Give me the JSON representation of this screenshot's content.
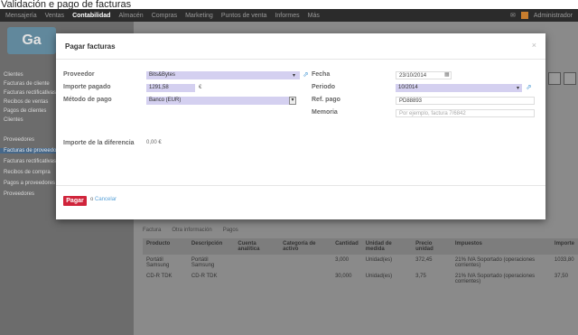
{
  "caption": "Validación e pago de facturas",
  "topbar": {
    "nav": [
      "Mensajería",
      "Ventas",
      "Contabilidad",
      "Almacén",
      "Compras",
      "Marketing",
      "Puntos de venta",
      "Informes",
      "Más"
    ],
    "active_index": 2,
    "user": "Administrador"
  },
  "sidebar": {
    "logo": "Ga",
    "items": [
      "Clientes",
      "Facturas de cliente",
      "Facturas rectificativas",
      "Recibos de ventas",
      "Pagos de clientes",
      "Clientes",
      "Proveedores",
      "Facturas de proveedor",
      "Facturas rectificativas",
      "Recibos de compra",
      "Pagos a proveedores",
      "Proveedores"
    ],
    "selected_index": 7
  },
  "modal": {
    "title": "Pagar facturas",
    "close": "×",
    "proveedor_label": "Proveedor",
    "proveedor_value": "Bits&Bytes",
    "importe_label": "Importe pagado",
    "importe_value": "1291,58",
    "currency": "€",
    "metodo_label": "Método de pago",
    "metodo_value": "Banco (EUR)",
    "fecha_label": "Fecha",
    "fecha_value": "23/10/2014",
    "periodo_label": "Periodo",
    "periodo_value": "10/2014",
    "ref_label": "Ref. pago",
    "ref_value": "PD88893",
    "memoria_label": "Memoria",
    "memoria_placeholder": "Por ejemplo, factura 7/6842",
    "diferencia_label": "Importe de la diferencia",
    "diferencia_value": "0,00 €",
    "pay_button": "Pagar",
    "cancel_or": "o",
    "cancel_link": "Cancelar"
  },
  "main": {
    "tabs": [
      "Factura",
      "Otra información",
      "Pagos"
    ],
    "columns": [
      "Producto",
      "Descripción",
      "Cuenta analítica",
      "Categoría de activo",
      "Cantidad",
      "Unidad de medida",
      "Precio unidad",
      "Impuestos",
      "Importe"
    ],
    "rows": [
      [
        "Portátil Samsung",
        "Portátil Samsung",
        "",
        "",
        "3,000",
        "Unidad(es)",
        "372,45",
        "21% IVA Soportado (operaciones corrientes)",
        "1033,80"
      ],
      [
        "CD-R TDK",
        "CD-R TDK",
        "",
        "",
        "30,000",
        "Unidad(es)",
        "3,75",
        "21% IVA Soportado (operaciones corrientes)",
        "37,50"
      ]
    ]
  }
}
